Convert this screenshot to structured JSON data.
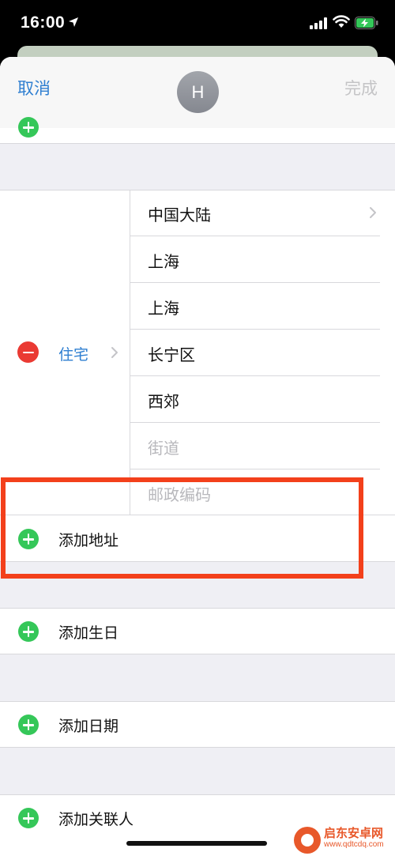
{
  "status_bar": {
    "time": "16:00"
  },
  "nav": {
    "cancel_label": "取消",
    "done_label": "完成",
    "avatar_initial": "H"
  },
  "address": {
    "type_label": "住宅",
    "fields": [
      {
        "value": "中国大陆",
        "placeholder": false
      },
      {
        "value": "上海",
        "placeholder": false
      },
      {
        "value": "上海",
        "placeholder": false
      },
      {
        "value": "长宁区",
        "placeholder": false
      },
      {
        "value": "西郊",
        "placeholder": false
      },
      {
        "value": "街道",
        "placeholder": true
      },
      {
        "value": "邮政编码",
        "placeholder": true
      }
    ]
  },
  "rows": {
    "add_address": "添加地址",
    "add_birthday": "添加生日",
    "add_date": "添加日期",
    "add_related": "添加关联人"
  },
  "watermark": {
    "name": "启东安卓网",
    "url": "www.qdtcdq.com"
  },
  "colors": {
    "accent": "#2f7fd1",
    "add": "#35c759",
    "delete": "#ea3a33",
    "highlight": "#f3401b"
  },
  "icons": [
    "location-arrow-icon",
    "signal-icon",
    "wifi-icon",
    "battery-charging-icon",
    "plus-circle-icon",
    "minus-circle-icon",
    "chevron-right-icon"
  ]
}
